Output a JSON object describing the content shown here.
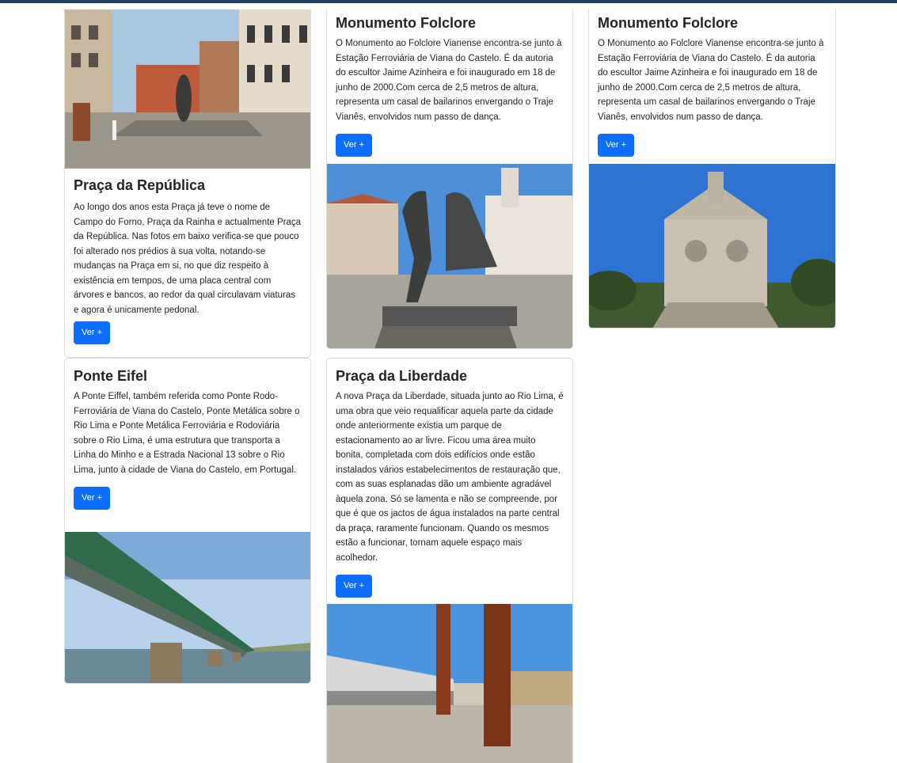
{
  "cards": [
    {
      "title": "Praça da República",
      "text": "Ao longo dos anos esta Praça já teve o nome de Campo do Forno, Praça da Rainha e actualmente Praça da República. Nas fotos em baixo verifica-se que pouco foi alterado nos prédios à sua volta, notando-se mudanças na Praça em si, no que diz respeito à existência em tempos, de uma placa central com árvores e bancos, ao redor da qual circulavam viaturas e agora é unicamente pedonal.",
      "button": "Ver +"
    },
    {
      "title": "Monumento Folclore",
      "text": "O Monumento ao Folclore Vianense encontra-se junto à Estação Ferroviária de Viana do Castelo. É da autoria do escultor Jaime Azinheira e foi inaugurado em 18 de junho de 2000.Com cerca de 2,5 metros de altura, representa um casal de bailarinos envergando o Traje Vianês, envolvidos num passo de dança.",
      "button": "Ver +"
    },
    {
      "title": "Monumento Folclore",
      "text": "O Monumento ao Folclore Vianense encontra-se junto à Estação Ferroviária de Viana do Castelo. É da autoria do escultor Jaime Azinheira e foi inaugurado em 18 de junho de 2000.Com cerca de 2,5 metros de altura, representa um casal de bailarinos envergando o Traje Vianês, envolvidos num passo de dança.",
      "button": "Ver +"
    },
    {
      "title": "Ponte Eifel",
      "text": "A Ponte Eiffel, também referida como Ponte Rodo-Ferroviária de Viana do Castelo, Ponte Metálica sobre o Rio Lima e Ponte Metálica Ferroviária e Rodoviária sobre o Rio Lima, é uma estrutura que transporta a Linha do Minho e a Estrada Nacional 13 sobre o Rio Lima, junto à cidade de Viana do Castelo, em Portugal.",
      "button": "Ver +"
    },
    {
      "title": "Praça da Liberdade",
      "text": "A nova Praça da Liberdade, situada junto ao Rio Lima, é uma obra que veio requalificar aquela parte da cidade onde anteriormente existia um parque de estacionamento ao ar livre. Ficou uma área muito bonita, completada com dois edifícios onde estão instalados vários estabelecimentos de restauração que, com as suas esplanadas dão um ambiente agradável àquela zona. Só se lamenta e não se compreende, por que é que os jactos de água instalados na parte central da praça, raramente funcionam. Quando os mesmos estão a funcionar, tornam aquele espaço mais acolhedor.",
      "button": "Ver +"
    }
  ],
  "colors": {
    "button": "#0d6efd",
    "topbar": "#1f3f64"
  }
}
